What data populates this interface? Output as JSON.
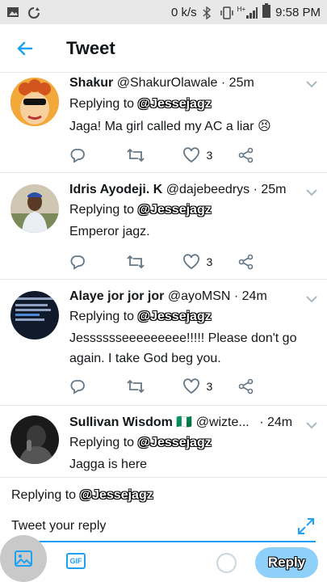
{
  "status_bar": {
    "network_speed": "0 k/s",
    "time": "9:58 PM",
    "network_type": "H+"
  },
  "app_bar": {
    "title": "Tweet",
    "back_icon": "arrow-left-icon"
  },
  "tweets": [
    {
      "name": "Shakur",
      "handle": "@ShakurOlawale",
      "time": "· 25m",
      "replying_prefix": "Replying to",
      "replying_to": "@Jessejagz",
      "text": "Jaga! Ma girl called my AC a liar 😣",
      "likes": "3"
    },
    {
      "name": "Idris Ayodeji. K",
      "handle": "@dajebeedrys",
      "time": "· 25m",
      "replying_prefix": "Replying to",
      "replying_to": "@Jessejagz",
      "text": "Emperor jagz.",
      "likes": "3"
    },
    {
      "name": "Alaye jor jor jor",
      "handle": "@ayoMSN",
      "time": "· 24m",
      "replying_prefix": "Replying to",
      "replying_to": "@Jessejagz",
      "text_line1": "Jesssssseeeeeeeee!!!!! Please don't go",
      "text_line2": "again. I take God beg you.",
      "likes": "3"
    },
    {
      "name": "Sullivan Wisdom",
      "flag": "🇳🇬",
      "handle": "@wizte...",
      "time": "· 24m",
      "replying_prefix": "Replying to",
      "replying_to": "@Jessejagz",
      "text": "Jagga is here"
    }
  ],
  "composer": {
    "replying_prefix": "Replying to",
    "replying_to": "@Jessejagz",
    "placeholder": "Tweet your reply",
    "gif_label": "GIF",
    "reply_button": "Reply"
  },
  "colors": {
    "accent": "#1da1f2",
    "reply_button_bg": "#8ed0f9",
    "status_bar_bg": "#e8e8e8"
  }
}
